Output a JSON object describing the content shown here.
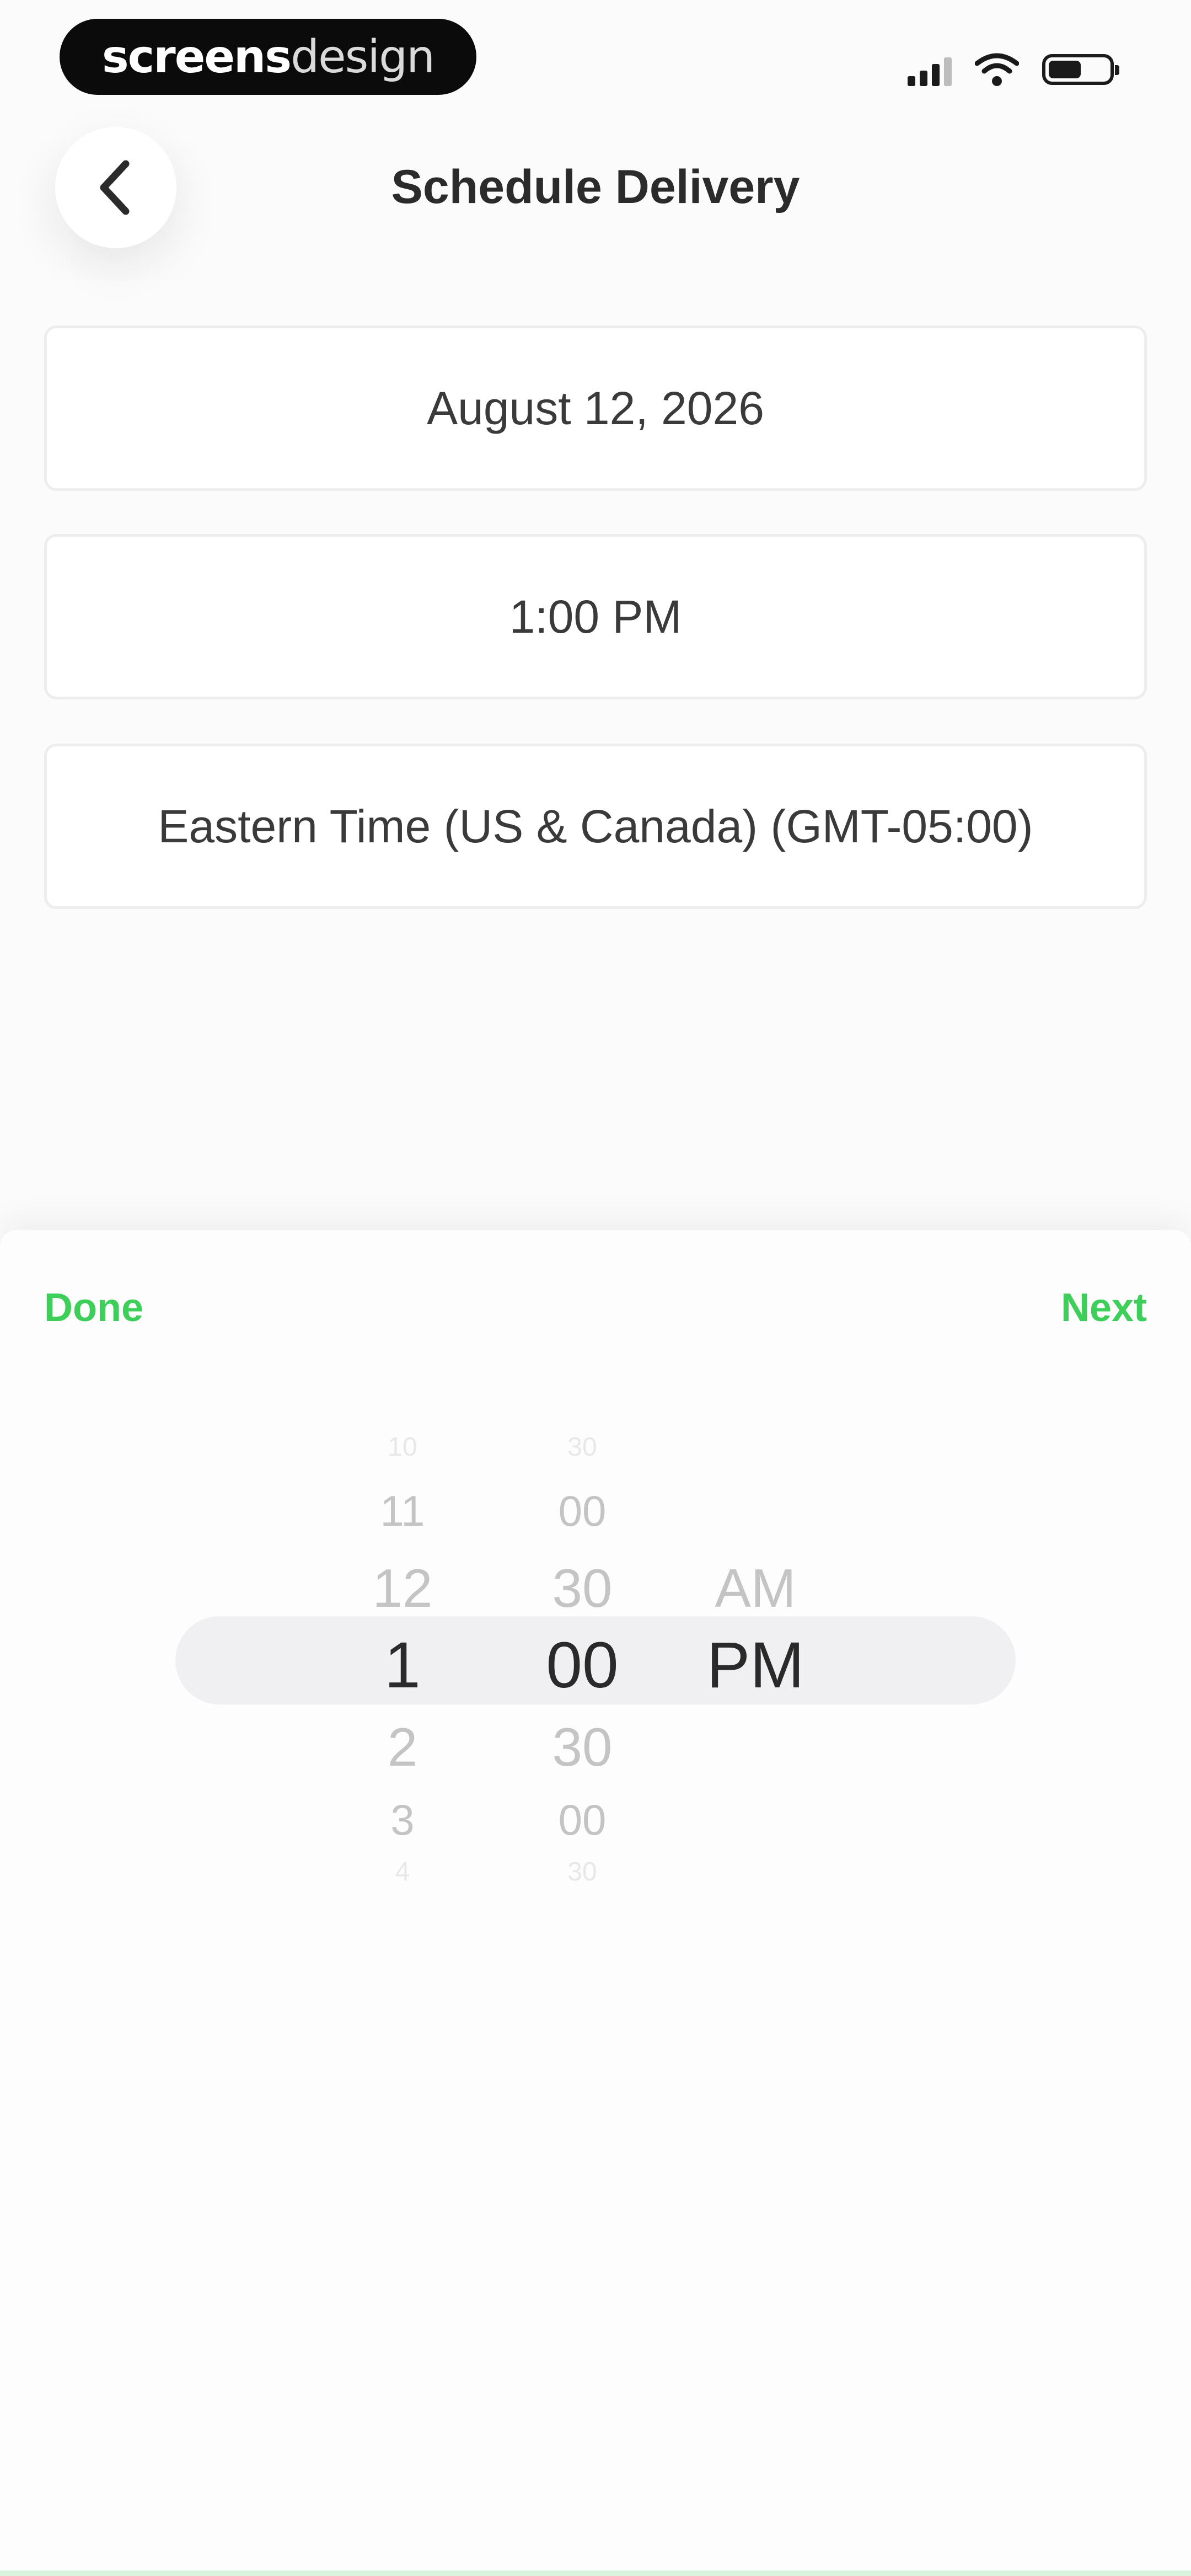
{
  "status_bar": {
    "brand_bold": "screens",
    "brand_light": "design"
  },
  "header": {
    "title": "Schedule Delivery",
    "back_icon": "chevron-left-icon"
  },
  "fields": {
    "date": "August 12, 2026",
    "time": "1:00 PM",
    "timezone": "Eastern Time (US & Canada) (GMT-05:00)"
  },
  "sheet": {
    "done_label": "Done",
    "next_label": "Next",
    "accent_color": "#3ecf5a"
  },
  "picker": {
    "hours": [
      "10",
      "11",
      "12",
      "1",
      "2",
      "3",
      "4"
    ],
    "minutes": [
      "30",
      "00",
      "30",
      "00",
      "30",
      "00",
      "30"
    ],
    "ampm": [
      "AM",
      "PM"
    ],
    "selected": {
      "hour": "1",
      "minute": "00",
      "ampm": "PM"
    }
  }
}
